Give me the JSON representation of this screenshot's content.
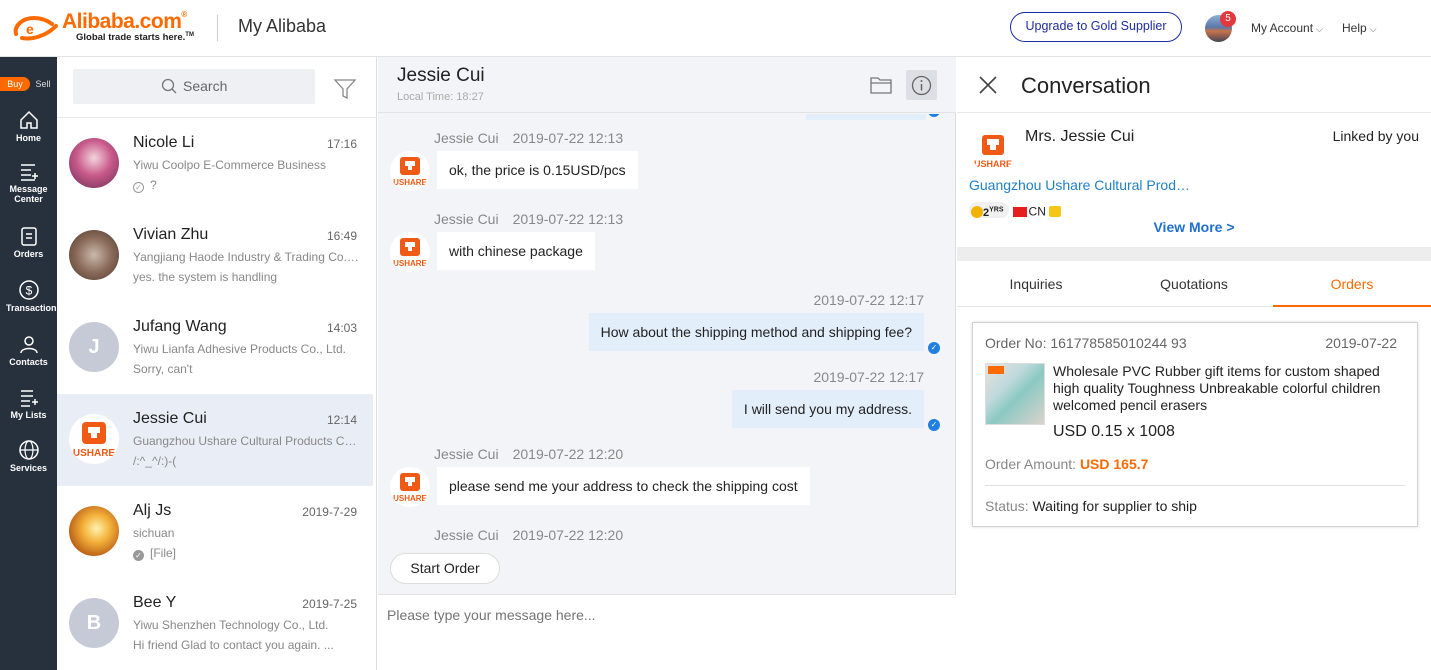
{
  "header": {
    "logo_text": "Alibaba.com",
    "logo_tagline": "Global trade starts here.",
    "app_title": "My Alibaba",
    "upgrade_button": "Upgrade to Gold Supplier",
    "notification_count": "5",
    "my_account": "My Account",
    "help": "Help",
    "brand_color": "#ff6a00"
  },
  "leftnav": {
    "buy": "Buy",
    "sell": "Sell",
    "items": [
      {
        "label": "Home",
        "icon": "home-icon"
      },
      {
        "label": "Message Center",
        "icon": "message-center-icon"
      },
      {
        "label": "Orders",
        "icon": "orders-icon"
      },
      {
        "label": "Transactions",
        "icon": "dollar-icon"
      },
      {
        "label": "Contacts",
        "icon": "contacts-icon"
      },
      {
        "label": "My Lists",
        "icon": "list-icon"
      },
      {
        "label": "Services",
        "icon": "globe-icon"
      }
    ]
  },
  "conversations": {
    "search_placeholder": "Search",
    "items": [
      {
        "name": "Nicole Li",
        "time": "17:16",
        "company": "Yiwu Coolpo E-Commerce Business",
        "last": "?"
      },
      {
        "name": "Vivian Zhu",
        "time": "16:49",
        "company": "Yangjiang Haode Industry & Trading Co., ...",
        "last": "yes. the system is handling"
      },
      {
        "name": "Jufang Wang",
        "time": "14:03",
        "company": "Yiwu Lianfa Adhesive Products Co., Ltd.",
        "last": "Sorry, can't",
        "initial": "J"
      },
      {
        "name": "Jessie Cui",
        "time": "12:14",
        "company": "Guangzhou Ushare Cultural Products Co., ...",
        "last": "/:^_^/:)-("
      },
      {
        "name": "Alj Js",
        "time": "2019-7-29",
        "company": "sichuan",
        "last": "[File]"
      },
      {
        "name": "Bee Y",
        "time": "2019-7-25",
        "company": "Yiwu Shenzhen Technology Co., Ltd.",
        "last": "Hi friend   Glad to contact you again. ...",
        "initial": "B"
      }
    ]
  },
  "chat": {
    "name": "Jessie Cui",
    "local_time": "Local Time: 18:27",
    "messages": [
      {
        "sender": "Jessie Cui",
        "time": "2019-07-22 12:13",
        "text": "ok, the price is 0.15USD/pcs"
      },
      {
        "sender": "Jessie Cui",
        "time": "2019-07-22 12:13",
        "text": "with chinese package"
      },
      {
        "time": "2019-07-22 12:17",
        "text": "How about the shipping method and shipping fee?"
      },
      {
        "time": "2019-07-22 12:17",
        "text": "I will send you my address."
      },
      {
        "sender": "Jessie Cui",
        "time": "2019-07-22 12:20",
        "text": "please send me your address to check the shipping cost"
      },
      {
        "sender": "Jessie Cui",
        "time": "2019-07-22 12:20"
      }
    ],
    "start_order": "Start Order",
    "input_placeholder": "Please type your message here..."
  },
  "panel": {
    "title": "Conversation",
    "contact_name": "Mrs. Jessie Cui",
    "linked": "Linked by you",
    "company": "Guangzhou Ushare Cultural Prod…",
    "years": "2",
    "years_unit": "YRS",
    "country": "CN",
    "view_more": "View More >",
    "tabs": [
      "Inquiries",
      "Quotations",
      "Orders"
    ],
    "active_tab": "Orders",
    "order": {
      "no_label": "Order No:",
      "no": "161778585010244 93",
      "date": "2019-07-22",
      "title": "Wholesale PVC Rubber gift items for custom shaped high quality Toughness Unbreakable colorful children welcomed pencil erasers",
      "price": "USD 0.15 x 1008",
      "amount_label": "Order Amount:",
      "amount": "USD 165.7",
      "status_label": "Status:",
      "status": "Waiting for supplier to ship"
    }
  }
}
